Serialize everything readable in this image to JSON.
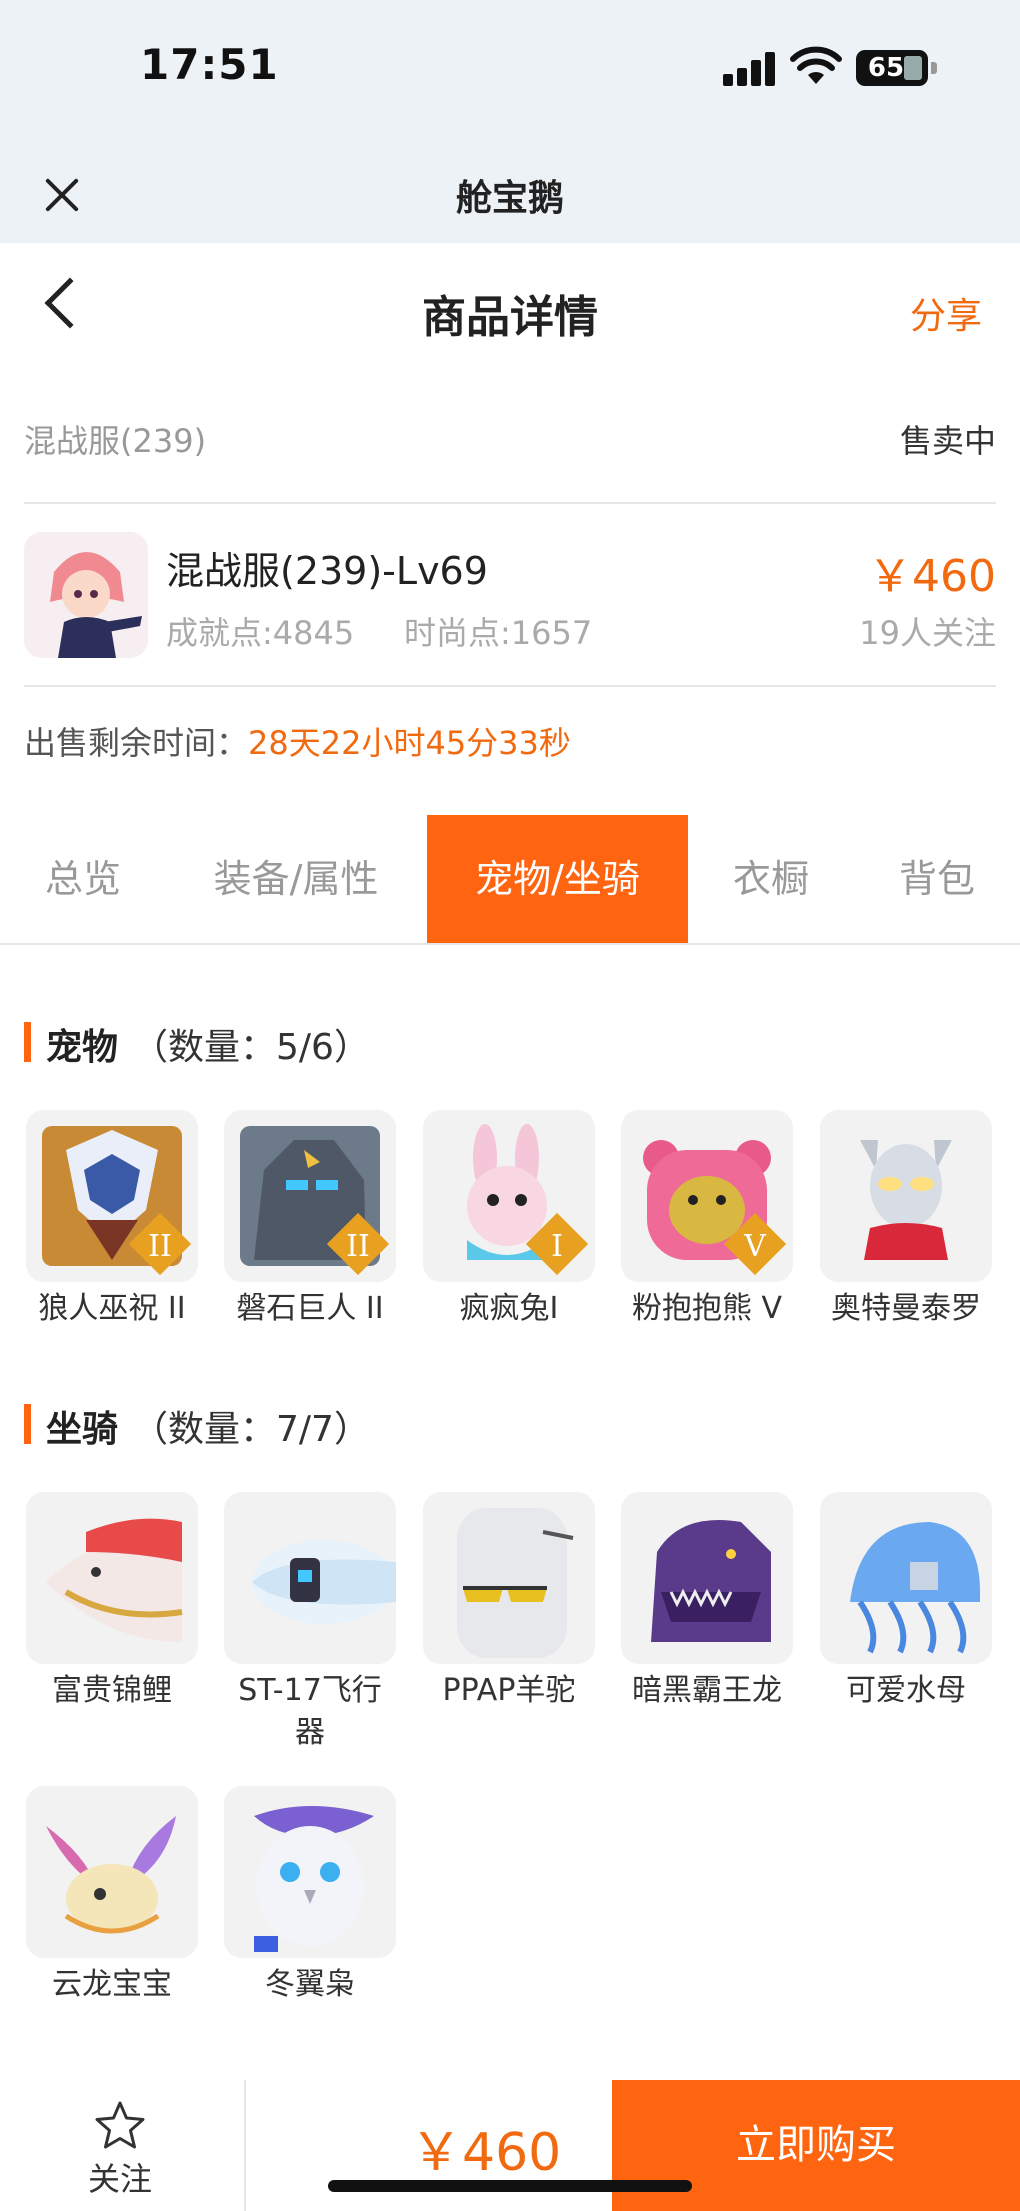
{
  "status_bar": {
    "time": "17:51",
    "battery": "65"
  },
  "miniapp": {
    "title": "舱宝鹅"
  },
  "nav": {
    "title": "商品详情",
    "share_label": "分享"
  },
  "listing": {
    "server": "混战服(239)",
    "status": "售卖中",
    "title": "混战服(239)-Lv69",
    "achievement": "成就点:4845",
    "fashion": "时尚点:1657",
    "price": "￥460",
    "followers": "19人关注",
    "remaining_label": "出售剩余时间：",
    "remaining_value": "28天22小时45分33秒"
  },
  "tabs": [
    {
      "label": "总览",
      "active": false
    },
    {
      "label": "装备/属性",
      "active": false
    },
    {
      "label": "宠物/坐骑",
      "active": true
    },
    {
      "label": "衣橱",
      "active": false
    },
    {
      "label": "背包",
      "active": false
    }
  ],
  "pets": {
    "title": "宠物",
    "count": "（数量：5/6）",
    "items": [
      {
        "name": "狼人巫祝 II",
        "badge": "II",
        "icon": "werewolf-shaman-icon"
      },
      {
        "name": "磐石巨人 II",
        "badge": "II",
        "icon": "rock-giant-icon"
      },
      {
        "name": "疯疯兔I",
        "badge": "I",
        "icon": "crazy-rabbit-icon"
      },
      {
        "name": "粉抱抱熊 V",
        "badge": "V",
        "icon": "pink-hug-bear-icon"
      },
      {
        "name": "奥特曼泰罗",
        "badge": "",
        "icon": "ultraman-taro-icon"
      }
    ]
  },
  "mounts": {
    "title": "坐骑",
    "count": "（数量：7/7）",
    "items": [
      {
        "name": "富贵锦鲤",
        "icon": "koi-fish-icon"
      },
      {
        "name": "ST-17飞行器",
        "icon": "aircraft-icon"
      },
      {
        "name": "PPAP羊驼",
        "icon": "alpaca-icon"
      },
      {
        "name": "暗黑霸王龙",
        "icon": "t-rex-icon"
      },
      {
        "name": "可爱水母",
        "icon": "jellyfish-icon"
      },
      {
        "name": "云龙宝宝",
        "icon": "cloud-dragon-icon"
      },
      {
        "name": "冬翼枭",
        "icon": "winter-owl-icon"
      }
    ]
  },
  "bottom": {
    "follow_label": "关注",
    "price": "￥460",
    "buy_label": "立即购买"
  },
  "colors": {
    "accent": "#ff6410",
    "price": "#f26a10",
    "header_bg": "#ecf2f6"
  }
}
